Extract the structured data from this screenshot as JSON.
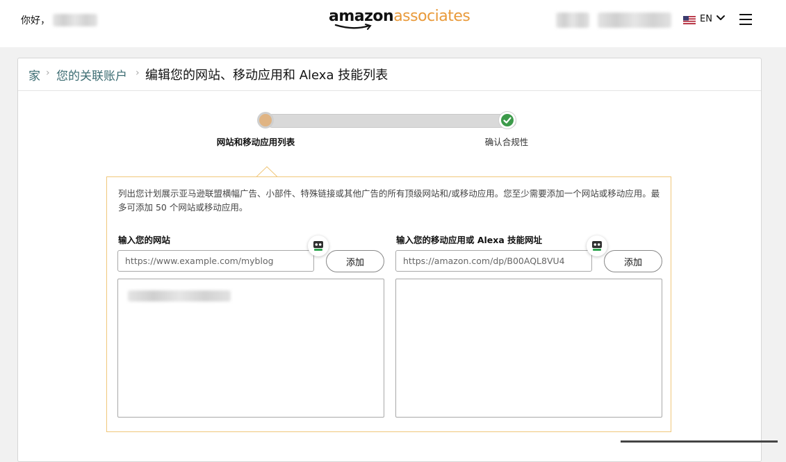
{
  "header": {
    "greeting": "你好，",
    "logo": {
      "part1": "amazon",
      "part2": "associates"
    },
    "language": "EN"
  },
  "breadcrumb": {
    "items": [
      {
        "label": "家"
      },
      {
        "label": "您的关联账户"
      }
    ],
    "current": "编辑您的网站、移动应用和 Alexa 技能列表",
    "separator": "›"
  },
  "steps": [
    {
      "label": "网站和移动应用列表",
      "active": true
    },
    {
      "label": "确认合规性",
      "active": false
    }
  ],
  "panel": {
    "description": "列出您计划展示亚马逊联盟横幅广告、小部件、特殊链接或其他广告的所有顶级网站和/或移动应用。您至少需要添加一个网站或移动应用。最多可添加 50 个网站或移动应用。",
    "website": {
      "label": "输入您的网站",
      "placeholder": "https://www.example.com/myblog",
      "add_label": "添加"
    },
    "app": {
      "label": "输入您的移动应用或 Alexa 技能网址",
      "placeholder": "https://amazon.com/dp/B00AQL8VU4",
      "add_label": "添加"
    }
  },
  "colors": {
    "brand_orange": "#e99a3a",
    "link": "#3a6b71",
    "panel_border": "#f0c77a",
    "check_green": "#3c9a4a"
  }
}
